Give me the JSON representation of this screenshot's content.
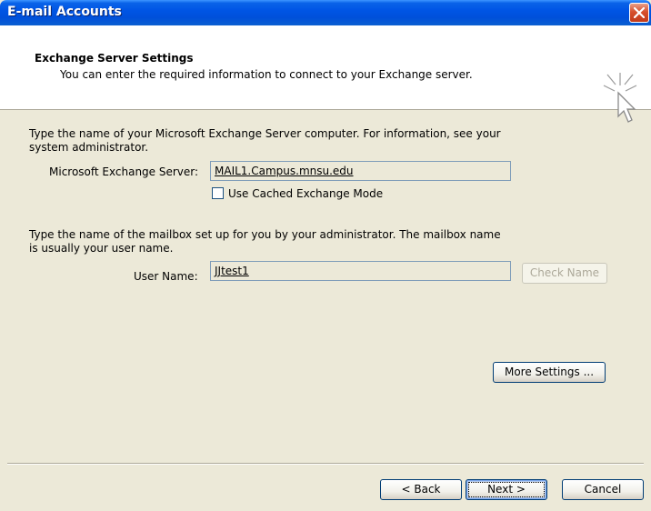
{
  "window": {
    "title": "E-mail Accounts"
  },
  "header": {
    "title": "Exchange Server Settings",
    "description": "You can enter the required information to connect to your Exchange server."
  },
  "server_section": {
    "instruction_line1": "Type the name of your Microsoft Exchange Server computer. For information, see your",
    "instruction_line2": "system administrator.",
    "label": "Microsoft Exchange Server:",
    "value": "MAIL1.Campus.mnsu.edu",
    "cached_mode_label": "Use Cached Exchange Mode",
    "cached_mode_checked": false
  },
  "mailbox_section": {
    "instruction_line1": "Type the name of the mailbox set up for you by your administrator. The mailbox name",
    "instruction_line2": "is usually your user name.",
    "label": "User Name:",
    "value": "JJtest1",
    "check_name_label": "Check Name"
  },
  "more_settings_label": "More Settings ...",
  "footer": {
    "back_label": "< Back",
    "next_label": "Next >",
    "cancel_label": "Cancel"
  },
  "colors": {
    "titlebar": "#0055E5",
    "dialog_bg": "#ECE9D8",
    "header_bg": "#FFFFFF",
    "close_button": "#D6502C"
  },
  "icons": {
    "close": "close-icon",
    "header": "wizard-cursor-icon"
  }
}
